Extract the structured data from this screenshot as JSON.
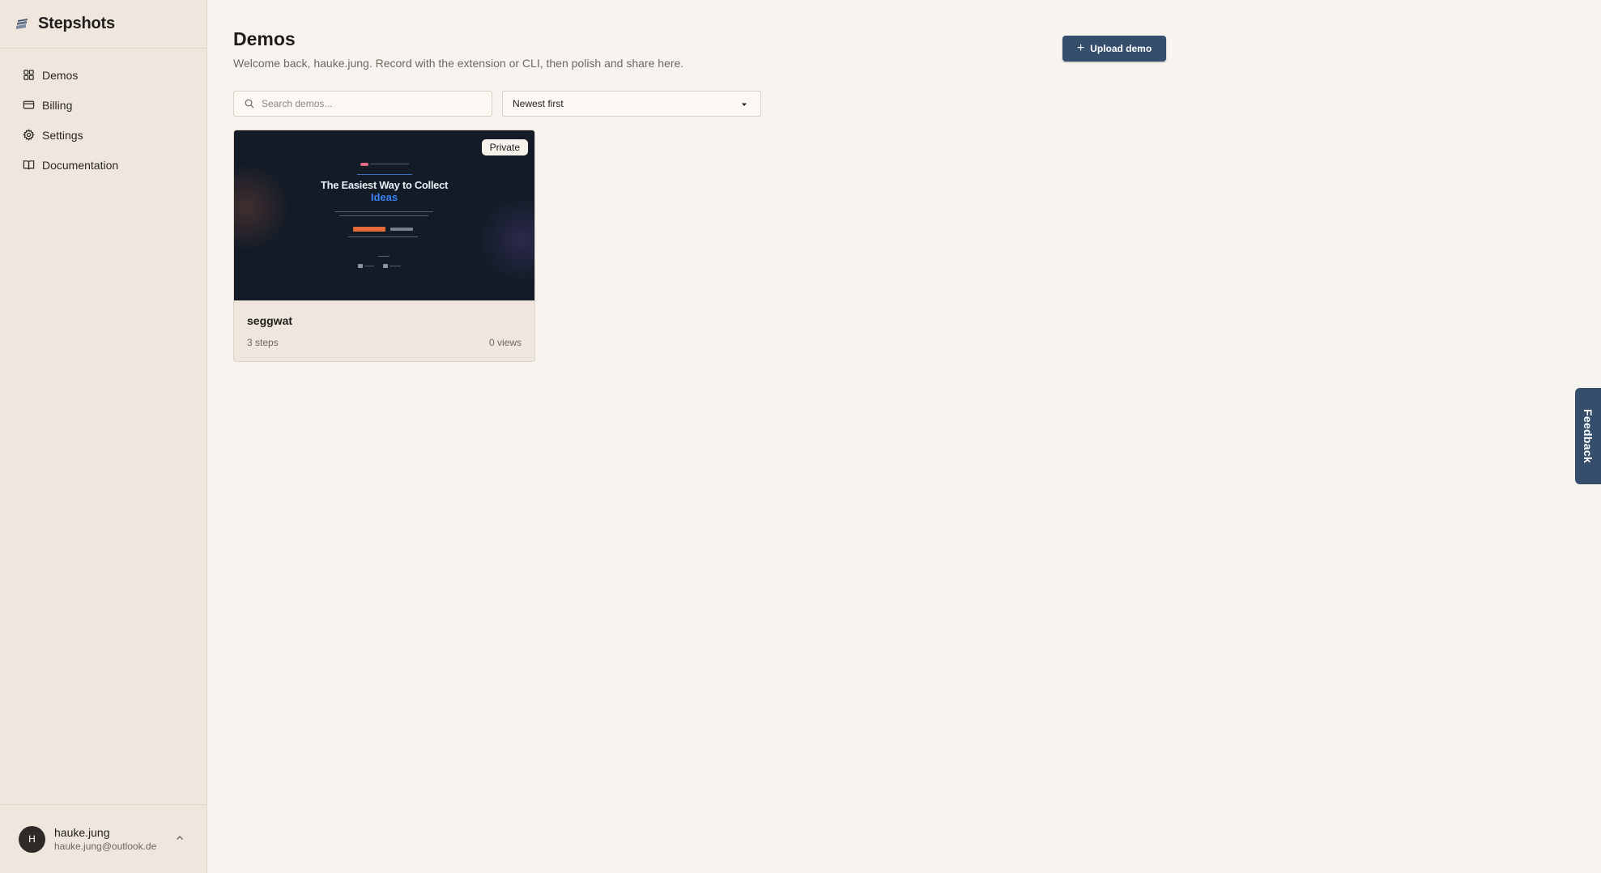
{
  "app": {
    "name": "Stepshots"
  },
  "sidebar": {
    "items": [
      {
        "label": "Demos",
        "icon": "grid-icon"
      },
      {
        "label": "Billing",
        "icon": "credit-card-icon"
      },
      {
        "label": "Settings",
        "icon": "gear-icon"
      },
      {
        "label": "Documentation",
        "icon": "book-icon"
      }
    ]
  },
  "user": {
    "initial": "H",
    "name": "hauke.jung",
    "email": "hauke.jung@outlook.de"
  },
  "main": {
    "title": "Demos",
    "subtitle": "Welcome back, hauke.jung. Record with the extension or CLI, then polish and share here.",
    "upload_label": "Upload demo",
    "search": {
      "placeholder": "Search demos...",
      "value": ""
    },
    "sort": {
      "selected": "Newest first"
    }
  },
  "demos": [
    {
      "title": "seggwat",
      "badge": "Private",
      "steps": "3 steps",
      "views": "0 views",
      "thumbnail": {
        "heading_line1": "The Easiest Way to Collect",
        "heading_line2": "Ideas"
      }
    }
  ],
  "feedback": {
    "label": "Feedback"
  },
  "colors": {
    "accent": "#344e6c",
    "sidebar_bg": "#efe7dd",
    "page_bg": "#f7f3ee"
  }
}
